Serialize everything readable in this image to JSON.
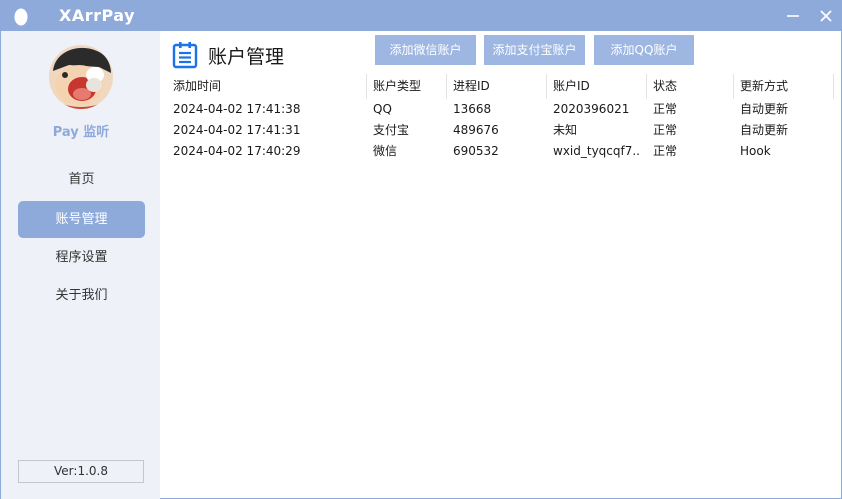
{
  "window": {
    "title": "XArrPay",
    "icon": "egg-icon",
    "controls": {
      "minimize_icon": "minimize-icon",
      "close_icon": "close-icon"
    }
  },
  "sidebar": {
    "app_name": "Pay 监听",
    "avatar": "cartoon-avatar",
    "items": [
      {
        "label": "首页",
        "active": false
      },
      {
        "label": "账号管理",
        "active": true
      },
      {
        "label": "程序设置",
        "active": false
      },
      {
        "label": "关于我们",
        "active": false
      }
    ],
    "version": "Ver:1.0.8"
  },
  "main": {
    "title": "账户管理",
    "title_icon": "list-icon",
    "buttons": {
      "add_wechat": "添加微信账户",
      "add_alipay": "添加支付宝账户",
      "add_qq": "添加QQ账户"
    },
    "table": {
      "columns": [
        "添加时间",
        "账户类型",
        "进程ID",
        "账户ID",
        "状态",
        "更新方式"
      ],
      "rows": [
        [
          "2024-04-02 17:41:38",
          "QQ",
          "13668",
          "2020396021",
          "正常",
          "自动更新"
        ],
        [
          "2024-04-02 17:41:31",
          "支付宝",
          "489676",
          "未知",
          "正常",
          "自动更新"
        ],
        [
          "2024-04-02 17:40:29",
          "微信",
          "690532",
          "wxid_tyqcqf7...",
          "正常",
          "Hook"
        ]
      ]
    }
  },
  "colors": {
    "accent": "#8eaadb",
    "button": "#9db6e2",
    "sidebar_bg": "#eef1f7",
    "title_icon": "#1a73e8"
  }
}
